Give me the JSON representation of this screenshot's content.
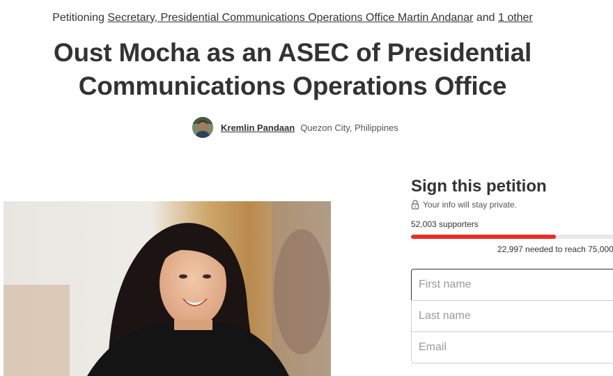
{
  "header": {
    "petitioning_prefix": "Petitioning",
    "target_primary": "Secretary, Presidential Communications Operations Office Martin Andanar",
    "and_text": "and",
    "target_other": "1 other"
  },
  "petition": {
    "title": "Oust Mocha as an ASEC of Presidential Communications Operations Office",
    "author_name": "Kremlin Pandaan",
    "author_location": "Quezon City, Philippines"
  },
  "sign": {
    "title": "Sign this petition",
    "privacy_note": "Your info will stay private.",
    "supporters_text": "52,003 supporters",
    "progress_fraction": 0.6934,
    "needed_text": "22,997 needed to reach 75,000",
    "progress_color": "#ec2c22"
  },
  "form": {
    "first_name_placeholder": "First name",
    "last_name_placeholder": "Last name",
    "email_placeholder": "Email"
  },
  "icons": {
    "lock": "lock-icon",
    "avatar": "avatar"
  }
}
